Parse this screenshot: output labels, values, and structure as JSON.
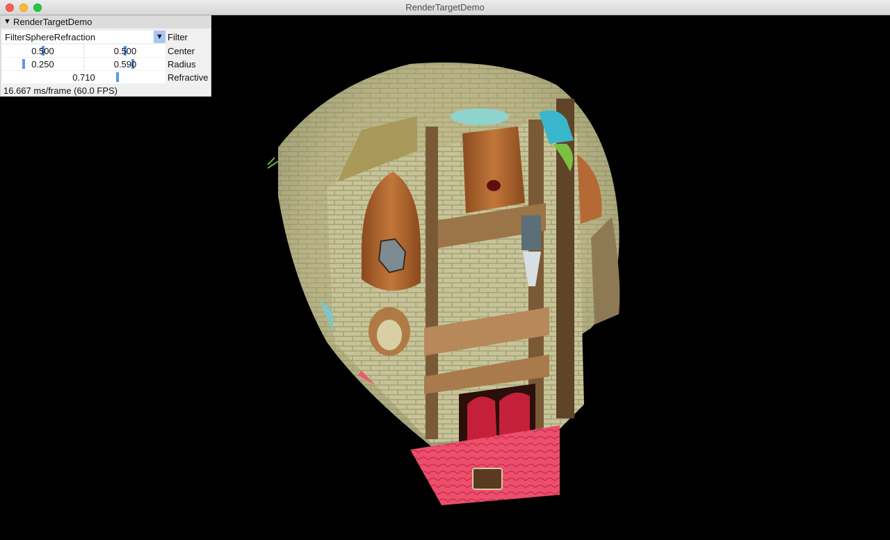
{
  "window": {
    "title": "RenderTargetDemo"
  },
  "panel": {
    "title": "RenderTargetDemo",
    "filter": {
      "value": "FilterSphereRefraction",
      "label": "Filter"
    },
    "center": {
      "x": "0.500",
      "y": "0.500",
      "label": "Center"
    },
    "radius": {
      "a": "0.250",
      "b": "0.590",
      "label": "Radius"
    },
    "refractive": {
      "value": "0.710",
      "label": "Refractive"
    },
    "fps_text": "16.667 ms/frame (60.0 FPS)"
  }
}
